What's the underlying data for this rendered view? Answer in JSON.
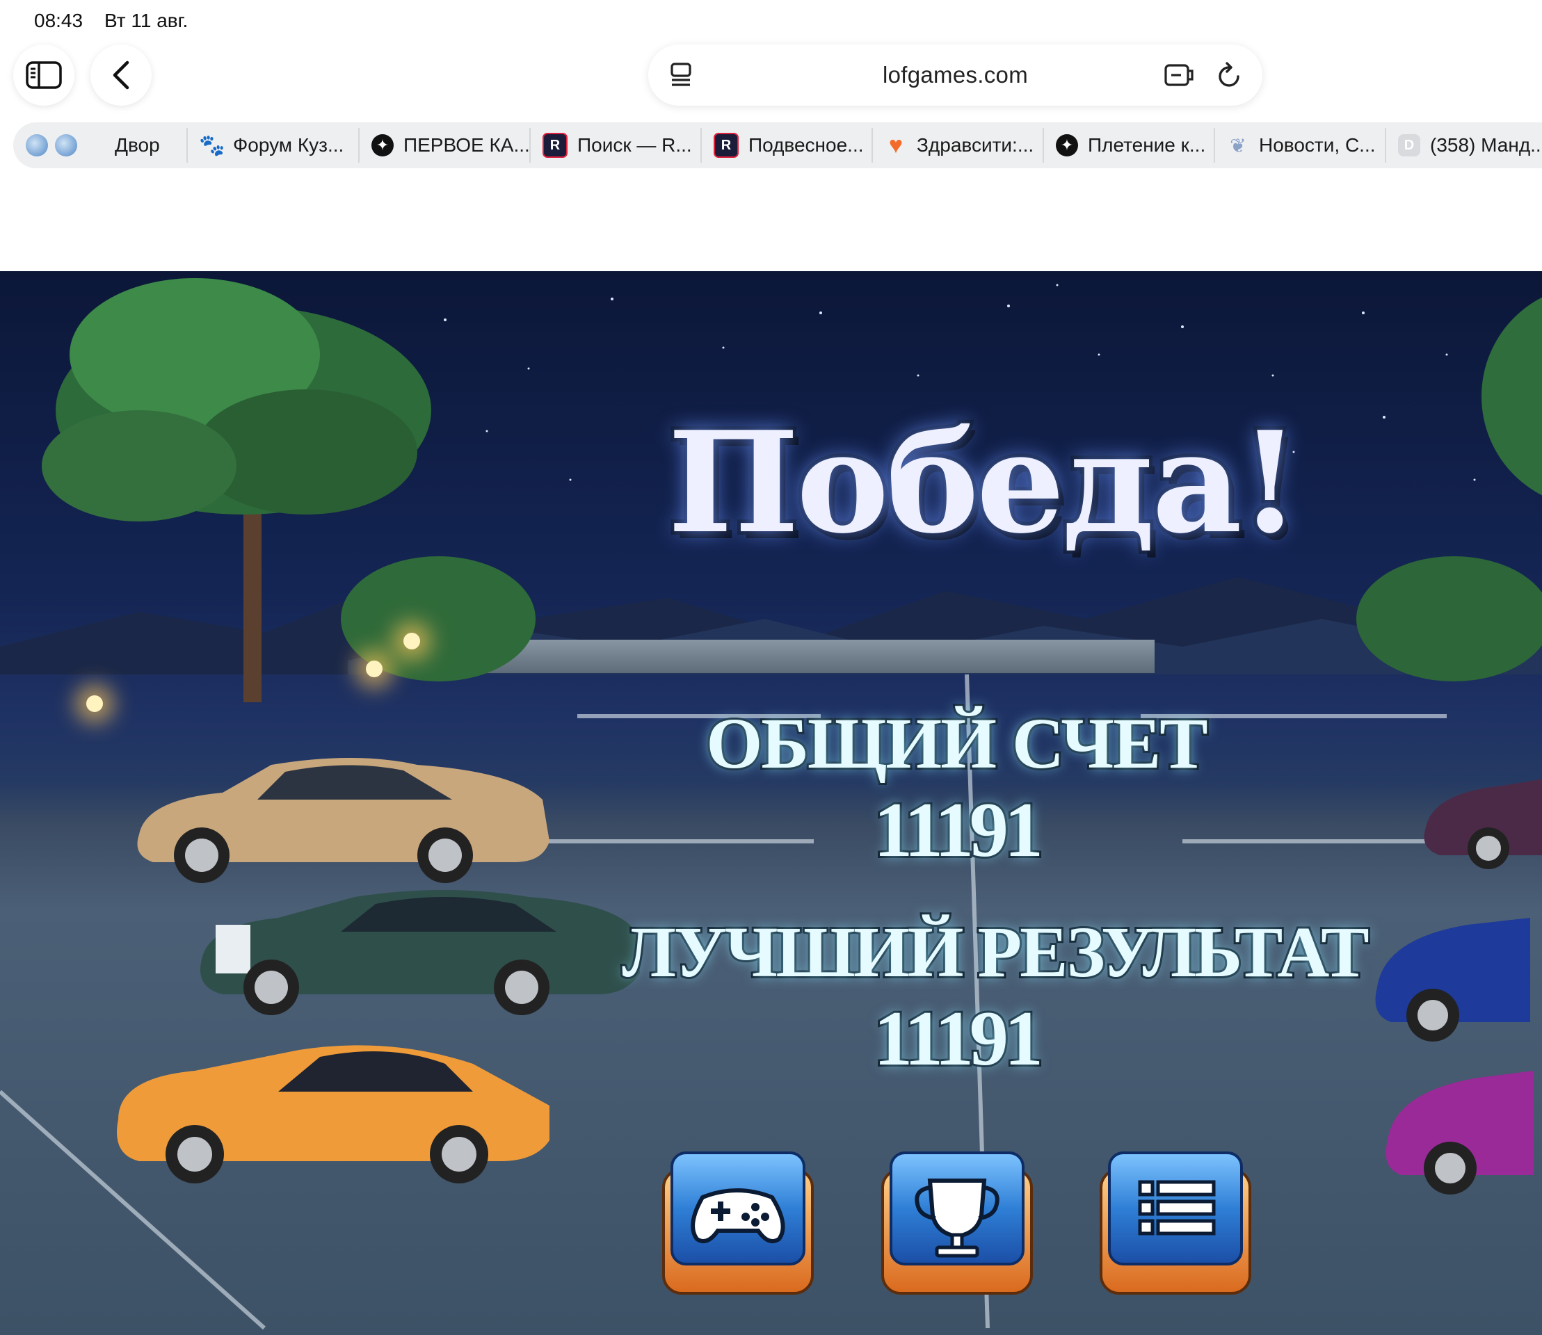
{
  "status_bar": {
    "time": "08:43",
    "date": "Вт 11 авг."
  },
  "browser": {
    "url": "lofgames.com",
    "icons": [
      "sidebar-icon",
      "back-chevron-icon",
      "reader-icon",
      "extension-icon",
      "reload-icon"
    ]
  },
  "bookmarks": [
    {
      "label": "Двор",
      "icon": "globe-icon"
    },
    {
      "label": "Форум Куз...",
      "icon": "paw-icon"
    },
    {
      "label": "ПЕРВОЕ КА...",
      "icon": "star-icon"
    },
    {
      "label": "Поиск — R...",
      "icon": "r-icon"
    },
    {
      "label": "Подвесное...",
      "icon": "r-icon"
    },
    {
      "label": "Здравсити:...",
      "icon": "heart-icon"
    },
    {
      "label": "Плетение к...",
      "icon": "star-icon"
    },
    {
      "label": "Новости, С...",
      "icon": "feather-icon"
    },
    {
      "label": "(358) Манд...",
      "icon": "d-icon"
    }
  ],
  "game": {
    "title": "Победа!",
    "score_label": "ОБЩИЙ СЧЕТ",
    "score_value": "11191",
    "best_label": "ЛУЧШИЙ РЕЗУЛЬТАТ",
    "best_value": "11191",
    "buttons": [
      "gamepad-icon",
      "trophy-icon",
      "list-icon"
    ]
  },
  "colors": {
    "sky": "#142554",
    "button_blue": "#2f7fd6",
    "button_orange": "#e98a2a"
  }
}
